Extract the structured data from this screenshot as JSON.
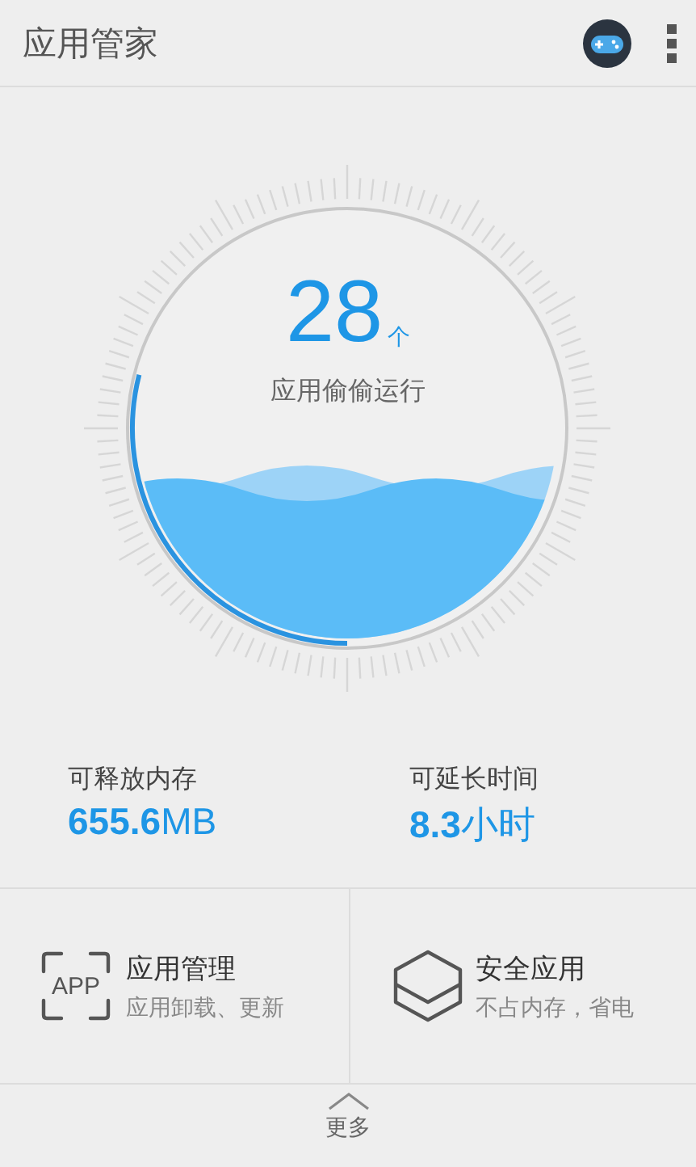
{
  "app_bar": {
    "title": "应用管家"
  },
  "gauge": {
    "count": "28",
    "unit": "个",
    "caption": "应用偷偷运行"
  },
  "stats": [
    {
      "label": "可释放内存",
      "value": "**655.6**MB"
    },
    {
      "label": "可延长时间",
      "value": "**8.3**小时"
    }
  ],
  "tiles": [
    {
      "kind": "app",
      "icon_text": "APP",
      "title": "应用管理",
      "subtitle": "应用卸载、更新"
    },
    {
      "kind": "hexagon",
      "title": "安全应用",
      "subtitle": "不占内存，省电"
    }
  ],
  "more": {
    "label": "更多"
  }
}
